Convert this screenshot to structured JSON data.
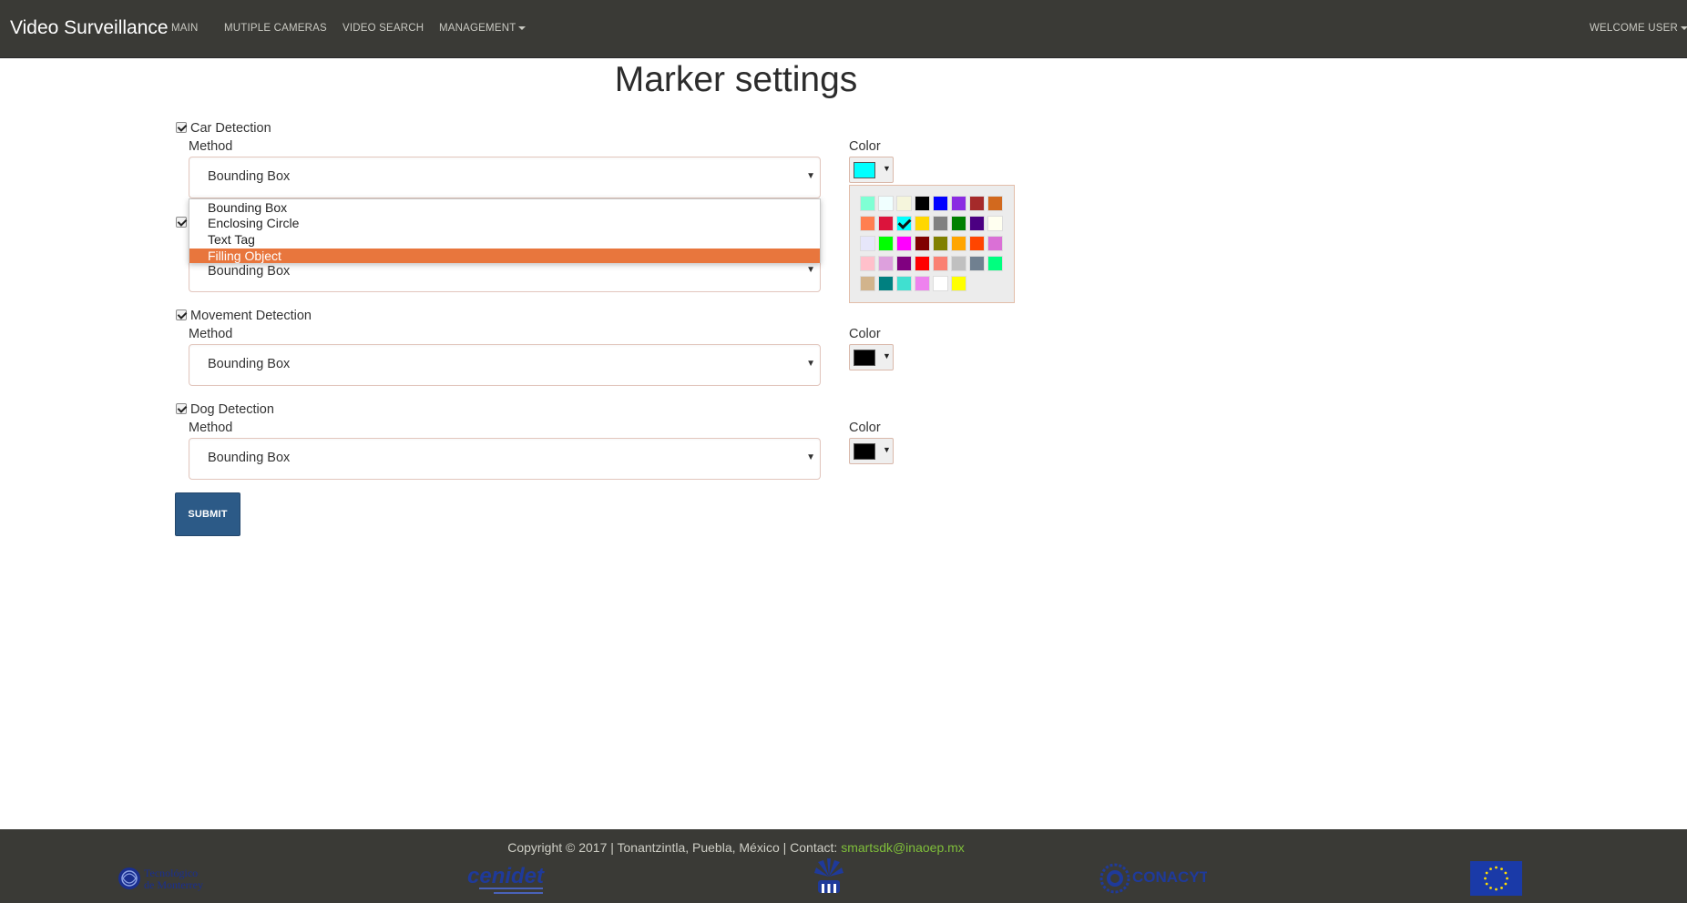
{
  "navbar": {
    "brand": "Video Surveillance",
    "items": [
      "MAIN",
      "MUTIPLE CAMERAS",
      "VIDEO SEARCH",
      "MANAGEMENT"
    ],
    "user_menu": "WELCOME USER"
  },
  "page": {
    "title": "Marker settings"
  },
  "form": {
    "method_label": "Method",
    "color_label": "Color",
    "detections": [
      {
        "label": "Car Detection",
        "checked": true,
        "method": "Bounding Box",
        "color": "#00ffff"
      },
      {
        "label": "",
        "checked": true,
        "method": "Bounding Box",
        "color": ""
      },
      {
        "label": "Movement Detection",
        "checked": true,
        "method": "Bounding Box",
        "color": "#000000"
      },
      {
        "label": "Dog Detection",
        "checked": true,
        "method": "Bounding Box",
        "color": "#000000"
      }
    ],
    "method_options": [
      "Bounding Box",
      "Enclosing Circle",
      "Text Tag",
      "Filling Object"
    ],
    "highlighted_option": "Filling Object",
    "submit_label": "SUBMIT"
  },
  "palette": {
    "selected": "#00ffff",
    "rows": [
      [
        "#7fffd4",
        "#f0ffff",
        "#f5f5dc",
        "#000000",
        "#0000ff",
        "#8a2be2",
        "#a52a2a",
        "#d2691e"
      ],
      [
        "#ff7f50",
        "#dc143c",
        "#00ffff",
        "#ffd700",
        "#808080",
        "#008000",
        "#4b0082",
        "#fffff0"
      ],
      [
        "#e6e6fa",
        "#00ff00",
        "#ff00ff",
        "#800000",
        "#808000",
        "#ffa500",
        "#ff4500",
        "#da70d6"
      ],
      [
        "#ffc0cb",
        "#dda0dd",
        "#800080",
        "#ff0000",
        "#fa8072",
        "#c0c0c0",
        "#708090",
        "#00ff7f"
      ],
      [
        "#d2b48c",
        "#008080",
        "#40e0d0",
        "#ee82ee",
        "#ffffff",
        "#ffff00"
      ]
    ]
  },
  "footer": {
    "copyright": "Copyright © 2017 | Tonantzintla, Puebla, México | Contact: ",
    "email": "smartsdk@inaoep.mx",
    "logos": {
      "tec_line1": "Tecnológico",
      "tec_line2": "de Monterrey",
      "cenidet": "cenidet",
      "conacyt": "CONACYT"
    }
  }
}
